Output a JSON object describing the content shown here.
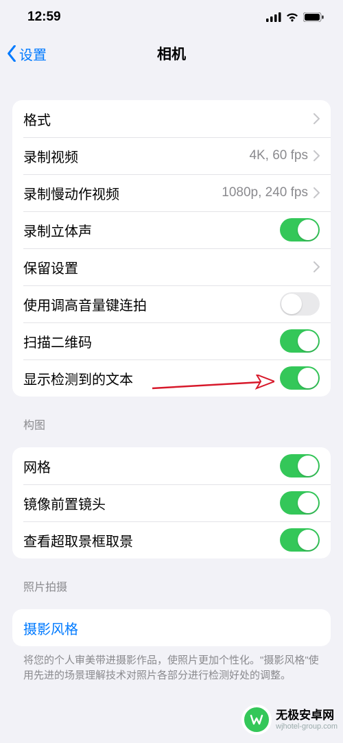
{
  "statusbar": {
    "time": "12:59"
  },
  "nav": {
    "back": "设置",
    "title": "相机"
  },
  "group1": {
    "formats": "格式",
    "record_video": "录制视频",
    "record_video_detail": "4K, 60 fps",
    "record_slomo": "录制慢动作视频",
    "record_slomo_detail": "1080p, 240 fps",
    "stereo": "录制立体声",
    "preserve": "保留设置",
    "burst_volume": "使用调高音量键连拍",
    "scan_qr": "扫描二维码",
    "show_detected_text": "显示检测到的文本"
  },
  "section2": {
    "header": "构图",
    "grid": "网格",
    "mirror_front": "镜像前置镜头",
    "view_outside_frame": "查看超取景框取景"
  },
  "section3": {
    "header": "照片拍摄",
    "photo_styles": "摄影风格",
    "footer": "将您的个人审美带进摄影作品，使照片更加个性化。\"摄影风格\"使用先进的场景理解技术对照片各部分进行检测好处的调整。"
  },
  "watermark": {
    "brand": "无极安卓网",
    "url": "wjhotel-group.com"
  }
}
